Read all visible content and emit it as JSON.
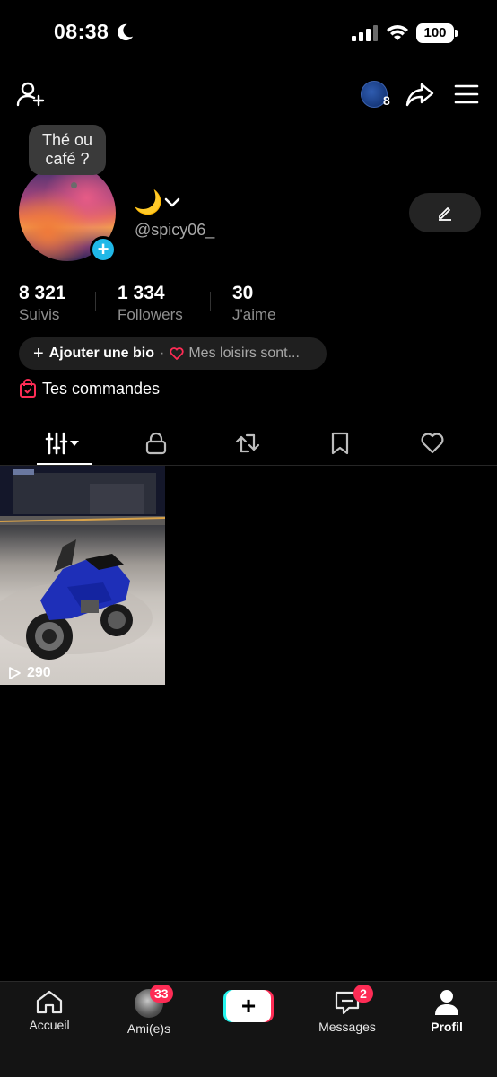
{
  "status_bar": {
    "time": "08:38",
    "battery": "100"
  },
  "header": {
    "coin_count": "8"
  },
  "profile": {
    "tooltip": "Thé ou café ?",
    "name_emoji": "🌙",
    "username": "@spicy06_"
  },
  "stats": [
    {
      "value": "8 321",
      "label": "Suivis"
    },
    {
      "value": "1 334",
      "label": "Followers"
    },
    {
      "value": "30",
      "label": "J'aime"
    }
  ],
  "bio": {
    "add_label": "Ajouter une bio",
    "separator": "·",
    "hint": "Mes loisirs sont..."
  },
  "orders": {
    "label": "Tes commandes"
  },
  "tabs": [
    "videos-grid-icon",
    "lock-icon",
    "repost-icon",
    "bookmark-icon",
    "heart-icon"
  ],
  "videos": [
    {
      "views": "290"
    }
  ],
  "bottom_nav": {
    "items": [
      {
        "label": "Accueil",
        "icon": "home-icon"
      },
      {
        "label": "Ami(e)s",
        "icon": "friends-avatar",
        "badge": "33"
      },
      {
        "label": "",
        "icon": "create-icon"
      },
      {
        "label": "Messages",
        "icon": "inbox-icon",
        "badge": "2"
      },
      {
        "label": "Profil",
        "icon": "profile-icon",
        "active": true
      }
    ]
  },
  "colors": {
    "background": "#000000",
    "accent_red": "#fe2c55",
    "accent_cyan": "#25f4ee",
    "plus_blue": "#20b8e8"
  }
}
